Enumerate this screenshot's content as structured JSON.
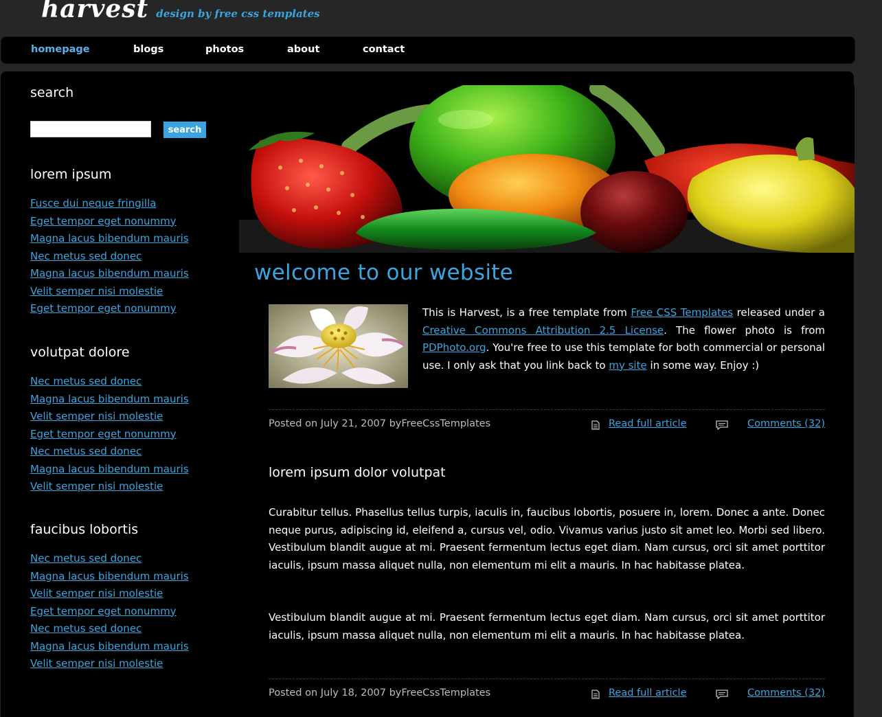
{
  "header": {
    "site_name": "harvest",
    "tagline": "design by free css templates"
  },
  "menu": {
    "items": [
      "homepage",
      "blogs",
      "photos",
      "about",
      "contact"
    ],
    "active": "homepage"
  },
  "sidebar": {
    "search": {
      "title": "search",
      "button_label": "search",
      "value": ""
    },
    "sections": [
      {
        "title": "lorem ipsum",
        "links": [
          "Fusce dui neque fringilla",
          "Eget tempor eget nonummy",
          "Magna lacus bibendum mauris",
          "Nec metus sed donec",
          "Magna lacus bibendum mauris",
          "Velit semper nisi molestie",
          "Eget tempor eget nonummy"
        ]
      },
      {
        "title": "volutpat dolore",
        "links": [
          "Nec metus sed donec",
          "Magna lacus bibendum mauris",
          "Velit semper nisi molestie",
          "Eget tempor eget nonummy",
          "Nec metus sed donec",
          "Magna lacus bibendum mauris",
          "Velit semper nisi molestie"
        ]
      },
      {
        "title": "faucibus lobortis",
        "links": [
          "Nec metus sed donec",
          "Magna lacus bibendum mauris",
          "Velit semper nisi molestie",
          "Eget tempor eget nonummy",
          "Nec metus sed donec",
          "Magna lacus bibendum mauris",
          "Velit semper nisi molestie"
        ]
      }
    ]
  },
  "main": {
    "welcome_title": "welcome to our website",
    "post1": {
      "t1": "This is Harvest, is a free template from ",
      "link_fct": "Free CSS Templates",
      "t2": " released under a ",
      "link_cc": "Creative Commons Attribution 2.5 License",
      "t3": ". The flower photo is from ",
      "link_pd": "PDPhoto.org",
      "t4": ". You're free to use this template for both commercial or personal use. I only ask that you link back to ",
      "link_site": "my site",
      "t5": " in some way. Enjoy :)",
      "posted": "Posted on July 21, 2007 byFreeCssTemplates",
      "read_more": "Read full article",
      "comments": "Comments (32)"
    },
    "post2": {
      "title": "lorem ipsum dolor volutpat",
      "para1": "Curabitur tellus. Phasellus tellus turpis, iaculis in, faucibus lobortis, posuere in, lorem. Donec a ante. Donec neque purus, adipiscing id, eleifend a, cursus vel, odio. Vivamus varius justo sit amet leo. Morbi sed libero. Vestibulum blandit augue at mi. Praesent fermentum lectus eget diam. Nam cursus, orci sit amet porttitor iaculis, ipsum massa aliquet nulla, non elementum mi elit a mauris. In hac habitasse platea.",
      "para2": "Vestibulum blandit augue at mi. Praesent fermentum lectus eget diam. Nam cursus, orci sit amet porttitor iaculis, ipsum massa aliquet nulla, non elementum mi elit a mauris. In hac habitasse platea.",
      "posted": "Posted on July 18, 2007 byFreeCssTemplates",
      "read_more": "Read full article",
      "comments": "Comments (32)"
    }
  },
  "icons": {
    "read_icon": "document-icon",
    "comments_icon": "speech-bubble-icon"
  },
  "colors": {
    "accent": "#3aa6e0",
    "background": "#262626",
    "panel": "#000000",
    "button": "#3ba3e0"
  }
}
